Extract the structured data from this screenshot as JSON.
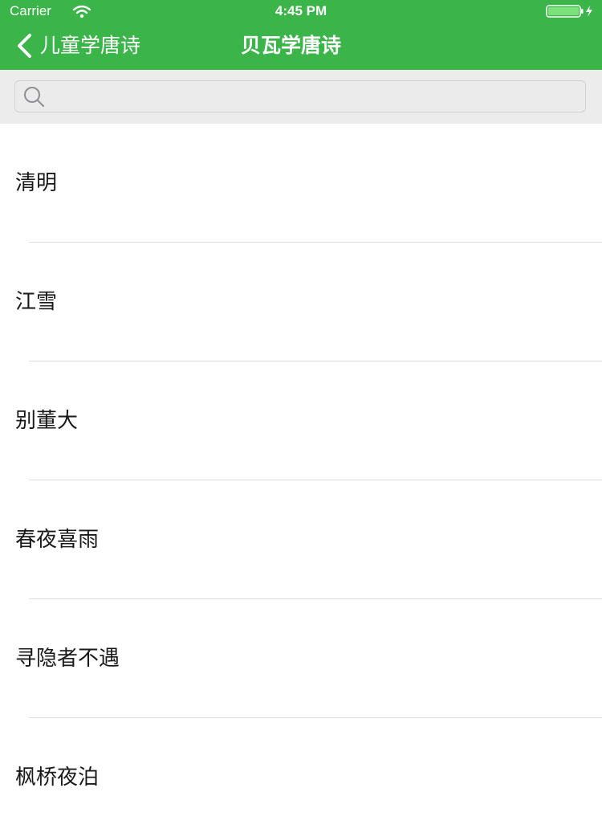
{
  "status_bar": {
    "carrier": "Carrier",
    "time": "4:45 PM"
  },
  "nav_bar": {
    "back_label": "儿童学唐诗",
    "title": "贝瓦学唐诗"
  },
  "search": {
    "placeholder": ""
  },
  "poems": [
    "清明",
    "江雪",
    "别董大",
    "春夜喜雨",
    "寻隐者不遇",
    "枫桥夜泊"
  ],
  "colors": {
    "accent": "#3bb54a",
    "battery": "#7ee07a"
  }
}
